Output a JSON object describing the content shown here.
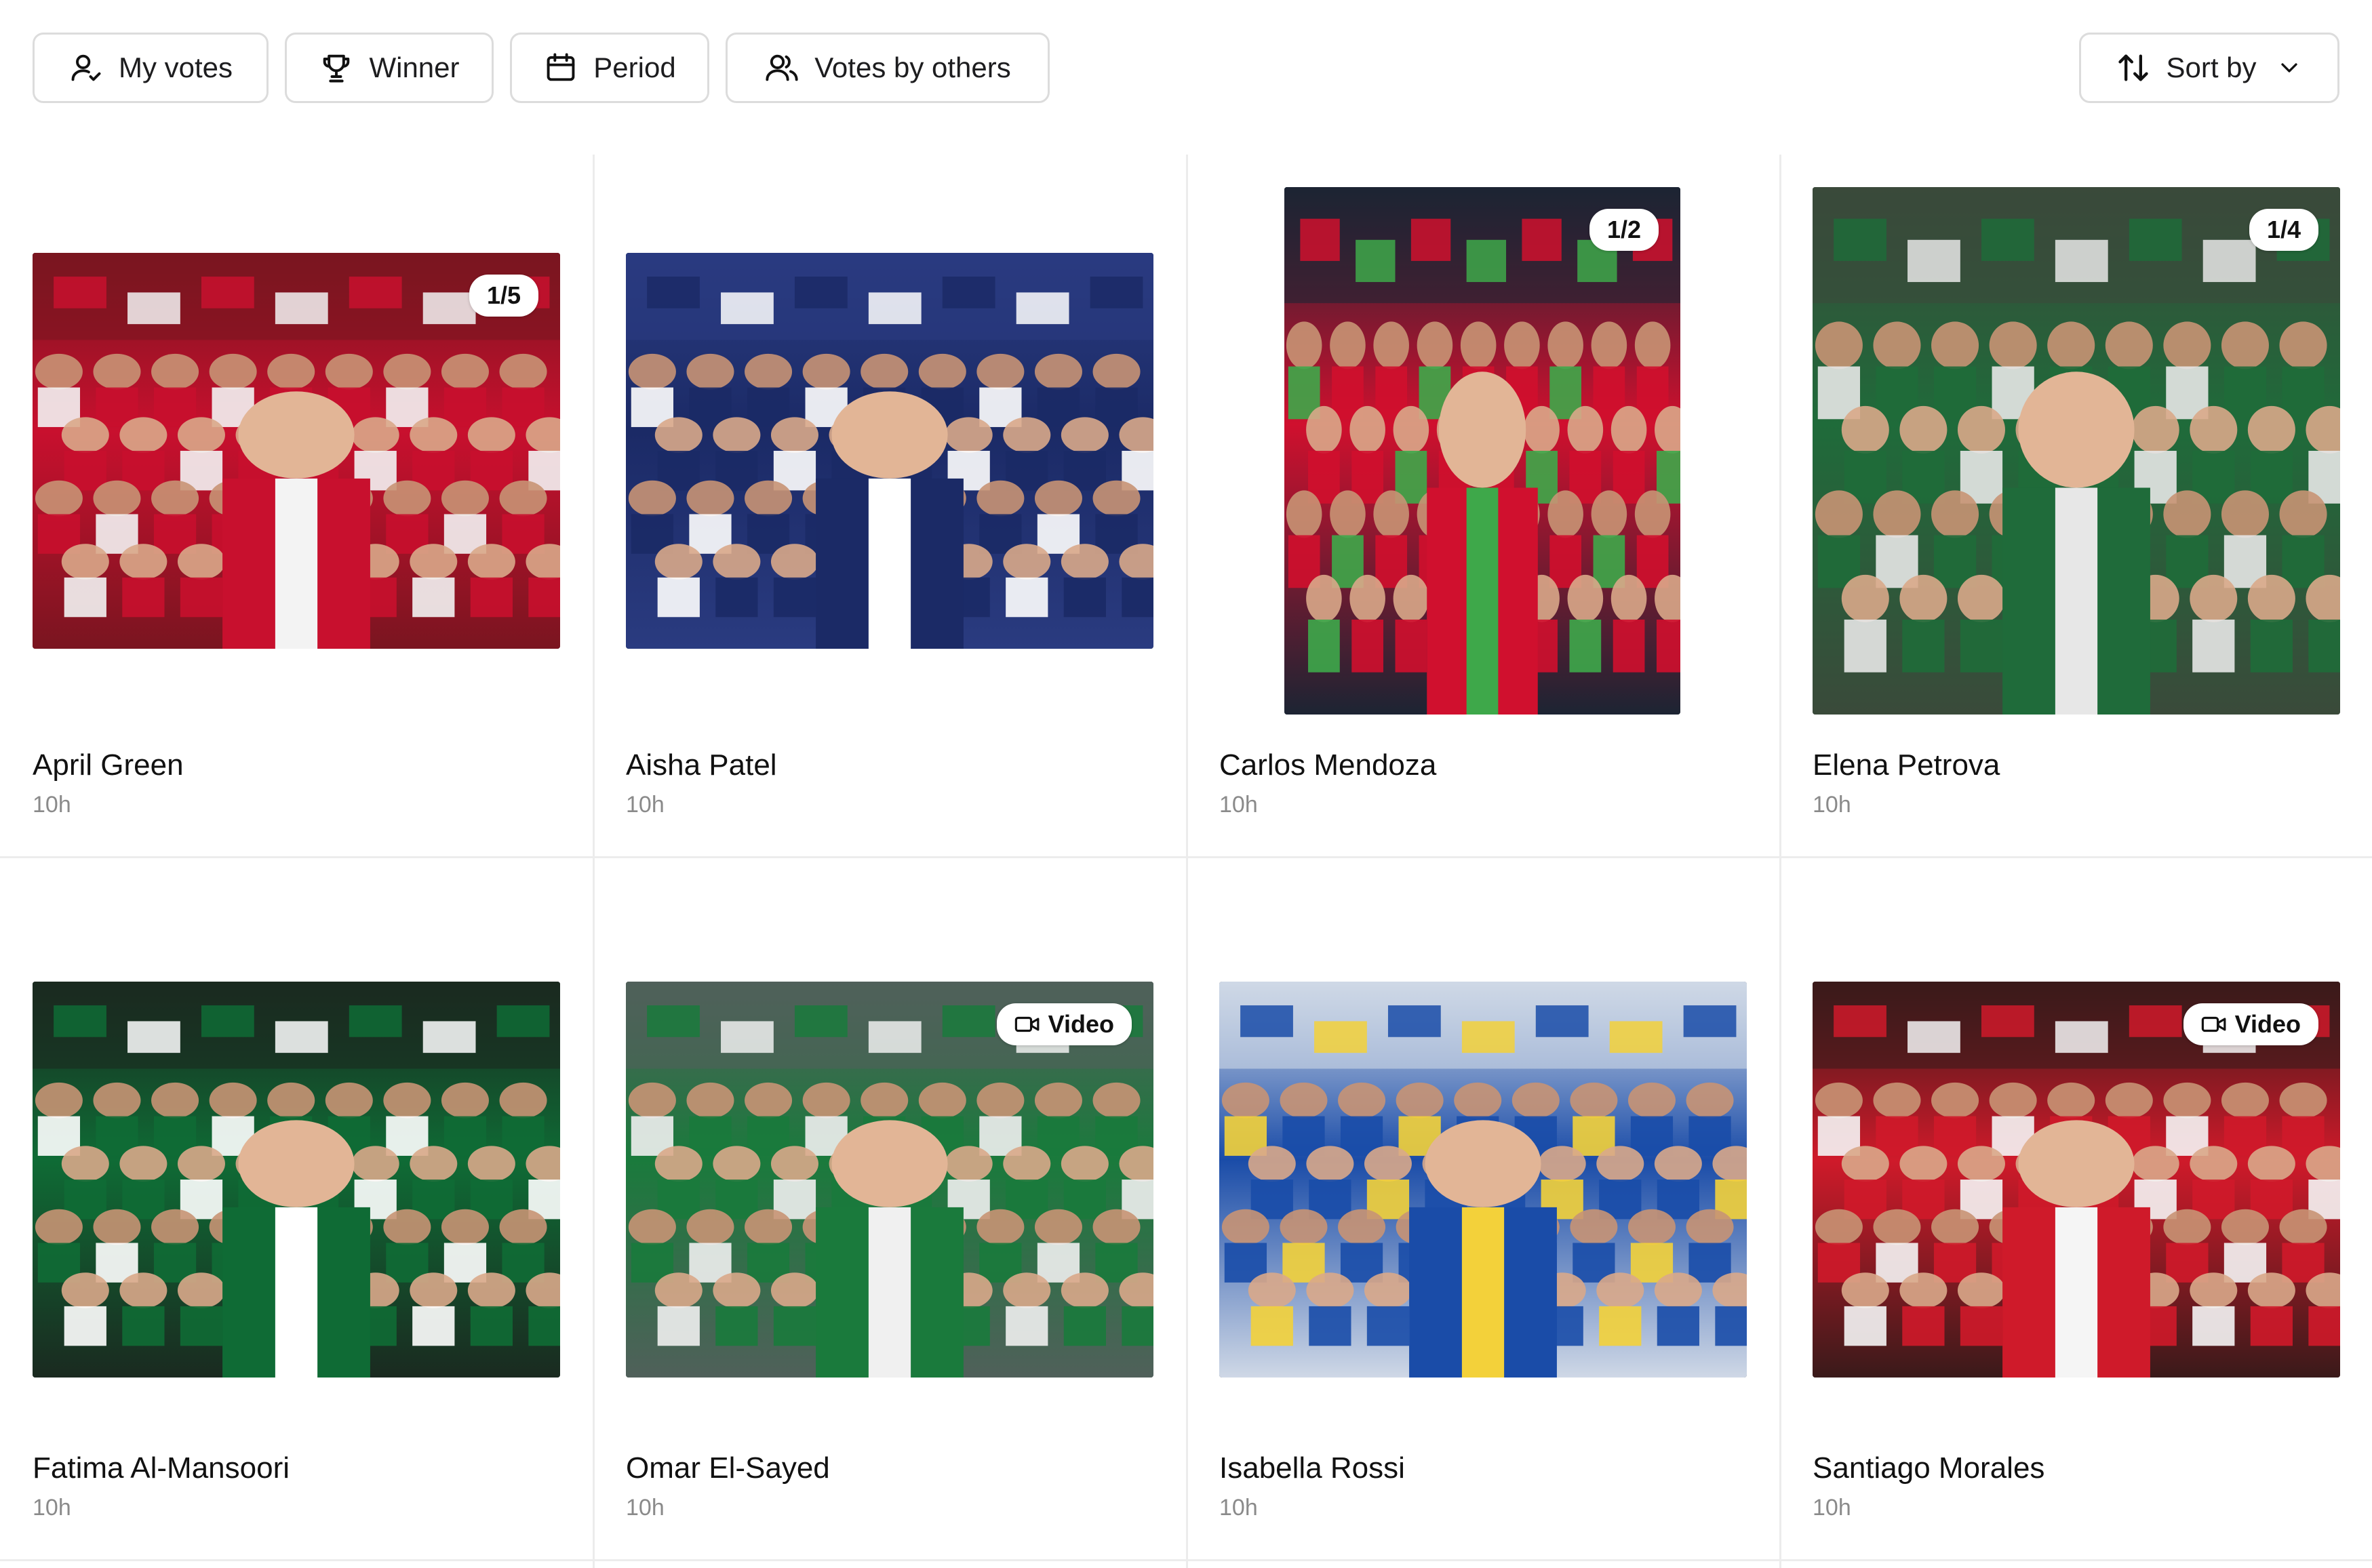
{
  "filters": {
    "my_votes": "My votes",
    "winner": "Winner",
    "period": "Period",
    "votes_by_others": "Votes by others",
    "sort_by": "Sort by"
  },
  "icons": {
    "my_votes": "user-check-icon",
    "winner": "trophy-icon",
    "period": "calendar-icon",
    "votes_by_others": "users-icon",
    "sort_by": "sort-arrows-icon",
    "sort_chevron": "chevron-down-icon",
    "video": "video-camera-icon"
  },
  "entries": [
    {
      "name": "April Green",
      "time": "10h",
      "badge": "1/5",
      "colors": [
        "#c8102e",
        "#f3f3f3",
        "#7a1520"
      ]
    },
    {
      "name": "Aisha Patel",
      "time": "10h",
      "badge": "",
      "colors": [
        "#1b2a66",
        "#ffffff",
        "#2a3b80"
      ]
    },
    {
      "name": "Carlos Mendoza",
      "time": "10h",
      "badge": "1/2",
      "colors": [
        "#d0102e",
        "#3ea84a",
        "#1c2433"
      ]
    },
    {
      "name": "Elena Petrova",
      "time": "10h",
      "badge": "1/4",
      "colors": [
        "#1f6b3a",
        "#e7e7e7",
        "#3a4a3a"
      ]
    },
    {
      "name": "Fatima Al-Mansoori",
      "time": "10h",
      "badge": "",
      "colors": [
        "#0f6b35",
        "#ffffff",
        "#1a2a20"
      ]
    },
    {
      "name": "Omar El-Sayed",
      "time": "10h",
      "badge": "Video",
      "colors": [
        "#1a7a3c",
        "#f0f0f0",
        "#50605a"
      ]
    },
    {
      "name": "Isabella Rossi",
      "time": "10h",
      "badge": "",
      "colors": [
        "#1a4ca8",
        "#f3d13a",
        "#cfd8e6"
      ]
    },
    {
      "name": "Santiago Morales",
      "time": "10h",
      "badge": "Video",
      "colors": [
        "#cf1a2a",
        "#f5f5f5",
        "#3a1a1a"
      ]
    }
  ]
}
